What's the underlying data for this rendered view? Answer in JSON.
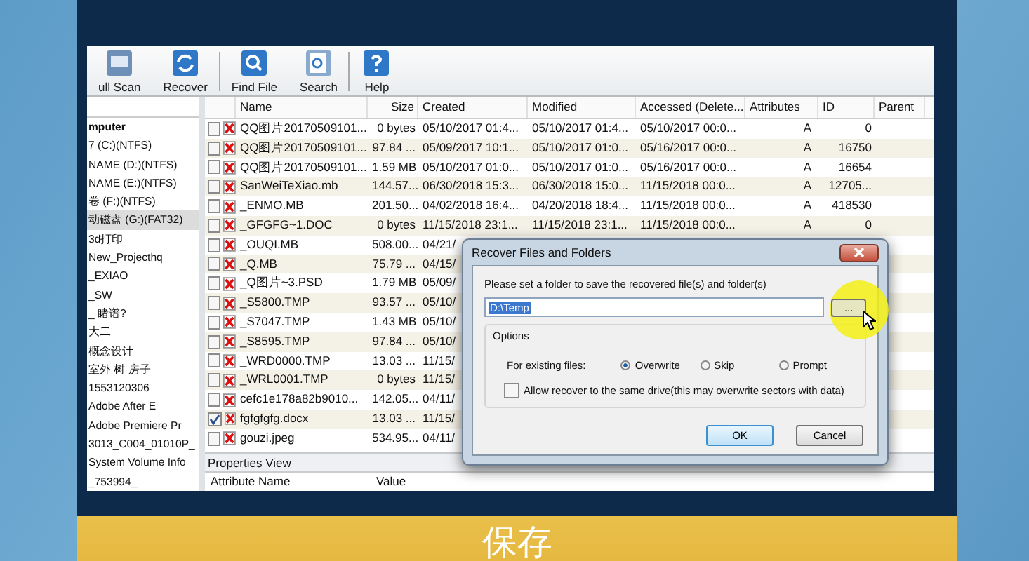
{
  "toolbar": [
    {
      "label": "ull Scan"
    },
    {
      "label": "Recover"
    },
    {
      "label": "Find File"
    },
    {
      "label": "Search"
    },
    {
      "label": "Help"
    }
  ],
  "tree": [
    {
      "label": "mputer",
      "kind": "root",
      "selected": false
    },
    {
      "label": "7 (C:)(NTFS)",
      "kind": "drive",
      "selected": false
    },
    {
      "label": "NAME (D:)(NTFS)",
      "kind": "drive",
      "selected": false
    },
    {
      "label": "NAME (E:)(NTFS)",
      "kind": "drive",
      "selected": false
    },
    {
      "label": "卷 (F:)(NTFS)",
      "kind": "drive",
      "selected": false
    },
    {
      "label": "动磁盘 (G:)(FAT32)",
      "kind": "drive",
      "selected": true
    },
    {
      "label": "3d打印",
      "kind": "folder",
      "selected": false
    },
    {
      "label": "New_Projecthq",
      "kind": "folder",
      "selected": false
    },
    {
      "label": "_EXIAO",
      "kind": "folder",
      "selected": false
    },
    {
      "label": "_SW",
      "kind": "folder",
      "selected": false
    },
    {
      "label": "_ 睹谱?",
      "kind": "folder",
      "selected": false
    },
    {
      "label": "大二",
      "kind": "folder",
      "selected": false
    },
    {
      "label": "概念设计",
      "kind": "folder",
      "selected": false
    },
    {
      "label": "室外 树 房子",
      "kind": "folder",
      "selected": false
    },
    {
      "label": "1553120306",
      "kind": "folder",
      "selected": false
    },
    {
      "label": "Adobe After E",
      "kind": "folder",
      "selected": false
    },
    {
      "label": "Adobe Premiere Pr",
      "kind": "folder",
      "selected": false
    },
    {
      "label": "3013_C004_01010P_",
      "kind": "folder",
      "selected": false
    },
    {
      "label": "System Volume Info",
      "kind": "folder",
      "selected": false
    },
    {
      "label": "_753994_",
      "kind": "folder",
      "selected": false
    }
  ],
  "table": {
    "columns": [
      "Name",
      "Size",
      "Created",
      "Modified",
      "Accessed (Delete...",
      "Attributes",
      "ID",
      "Parent"
    ],
    "rows": [
      {
        "checked": false,
        "cells": [
          "QQ图片20170509101...",
          "0 bytes",
          "05/10/2017 01:4...",
          "05/10/2017 01:4...",
          "05/10/2017 00:0...",
          "A",
          "0"
        ]
      },
      {
        "checked": false,
        "cells": [
          "QQ图片20170509101...",
          "97.84 ...",
          "05/09/2017 10:1...",
          "05/10/2017 01:0...",
          "05/16/2017 00:0...",
          "A",
          "16750"
        ]
      },
      {
        "checked": false,
        "cells": [
          "QQ图片20170509101...",
          "1.59 MB",
          "05/10/2017 01:0...",
          "05/10/2017 01:0...",
          "05/16/2017 00:0...",
          "A",
          "16654"
        ]
      },
      {
        "checked": false,
        "cells": [
          "SanWeiTeXiao.mb",
          "144.57...",
          "06/30/2018 15:3...",
          "06/30/2018 15:0...",
          "11/15/2018 00:0...",
          "A",
          "12705..."
        ]
      },
      {
        "checked": false,
        "cells": [
          "_ENMO.MB",
          "201.50...",
          "04/02/2018 16:4...",
          "04/20/2018 18:4...",
          "11/15/2018 00:0...",
          "A",
          "418530"
        ]
      },
      {
        "checked": false,
        "cells": [
          "_GFGFG~1.DOC",
          "0 bytes",
          "11/15/2018 23:1...",
          "11/15/2018 23:1...",
          "11/15/2018 00:0...",
          "A",
          "0"
        ]
      },
      {
        "checked": false,
        "cells": [
          "_OUQI.MB",
          "508.00...",
          "04/21/"
        ]
      },
      {
        "checked": false,
        "cells": [
          "_Q.MB",
          "75.79 ...",
          "04/15/"
        ]
      },
      {
        "checked": false,
        "cells": [
          "_Q图片~3.PSD",
          "1.79 MB",
          "05/09/"
        ]
      },
      {
        "checked": false,
        "cells": [
          "_S5800.TMP",
          "93.57 ...",
          "05/10/"
        ]
      },
      {
        "checked": false,
        "cells": [
          "_S7047.TMP",
          "1.43 MB",
          "05/10/"
        ]
      },
      {
        "checked": false,
        "cells": [
          "_S8595.TMP",
          "97.84 ...",
          "05/10/"
        ]
      },
      {
        "checked": false,
        "cells": [
          "_WRD0000.TMP",
          "13.03 ...",
          "11/15/"
        ]
      },
      {
        "checked": false,
        "cells": [
          "_WRL0001.TMP",
          "0 bytes",
          "11/15/"
        ]
      },
      {
        "checked": false,
        "cells": [
          "cefc1e178a82b9010...",
          "142.05...",
          "04/11/"
        ]
      },
      {
        "checked": true,
        "cells": [
          "fgfgfgfg.docx",
          "13.03 ...",
          "11/15/"
        ]
      },
      {
        "checked": false,
        "cells": [
          "gouzi.jpeg",
          "534.95...",
          "04/11/"
        ]
      }
    ]
  },
  "properties": {
    "title": "Properties View",
    "columns": [
      "Attribute Name",
      "Value"
    ]
  },
  "dialog": {
    "title": "Recover Files and Folders",
    "prompt": "Please set a folder to save the recovered file(s) and folder(s)",
    "path": "D:\\Temp",
    "browse": "...",
    "group": "Options",
    "existing_label": "For existing files:",
    "radios": [
      {
        "label": "Overwrite",
        "selected": true
      },
      {
        "label": "Skip",
        "selected": false
      },
      {
        "label": "Prompt",
        "selected": false
      }
    ],
    "same_drive": {
      "label": "Allow recover to the same drive(this may overwrite sectors with data)",
      "checked": false
    },
    "buttons": [
      {
        "label": "OK",
        "default": true
      },
      {
        "label": "Cancel",
        "default": false
      }
    ]
  },
  "caption": "保存"
}
